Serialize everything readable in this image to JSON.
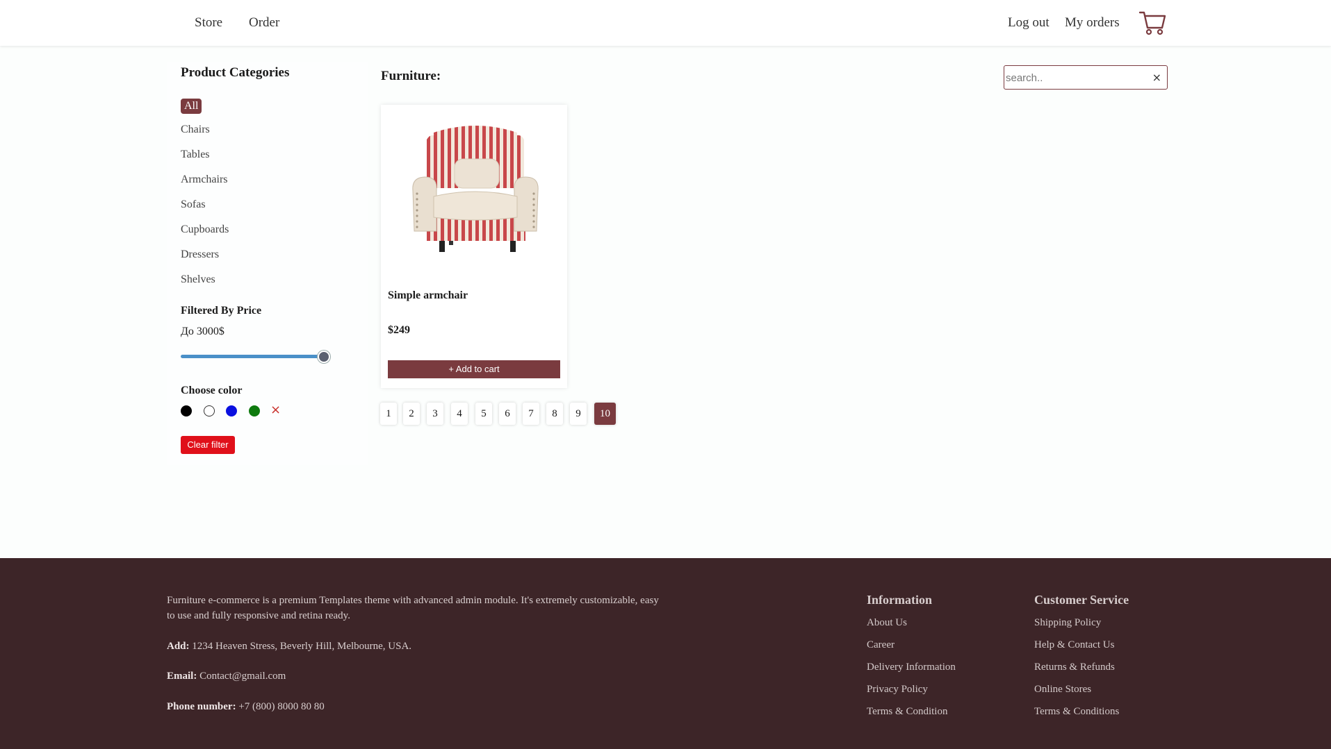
{
  "header": {
    "nav": [
      {
        "label": "Store"
      },
      {
        "label": "Order"
      }
    ],
    "right": [
      {
        "label": "Log out"
      },
      {
        "label": "My orders"
      }
    ],
    "cart_icon": "shopping-cart-icon"
  },
  "sidebar": {
    "title": "Product Categories",
    "categories": [
      {
        "label": "All",
        "selected": true
      },
      {
        "label": "Chairs"
      },
      {
        "label": "Tables"
      },
      {
        "label": "Armchairs"
      },
      {
        "label": "Sofas"
      },
      {
        "label": "Cupboards"
      },
      {
        "label": "Dressers"
      },
      {
        "label": "Shelves"
      }
    ],
    "price_title": "Filtered By Price",
    "price_value": "До 3000$",
    "price_slider_fraction": 1,
    "color_title": "Choose color",
    "colors": [
      "#000000",
      "#ffffff",
      "#0a10e0",
      "#0e7a0e"
    ],
    "color_clear": "×",
    "clear_filter": "Clear filter"
  },
  "main": {
    "title": "Furniture:",
    "search": {
      "placeholder": "search..",
      "value": "",
      "clear": "×"
    },
    "products": [
      {
        "name": "Simple armchair",
        "price": "$249",
        "button": "+ Add to cart"
      }
    ],
    "pages": [
      "1",
      "2",
      "3",
      "4",
      "5",
      "6",
      "7",
      "8",
      "9",
      "10"
    ],
    "current_page": "10"
  },
  "footer": {
    "about": "Furniture e-commerce is a premium Templates theme with advanced admin module. It's extremely customizable, easy to use and fully responsive and retina ready.",
    "address_label": "Add:",
    "address": "1234 Heaven Stress, Beverly Hill, Melbourne, USA.",
    "email_label": "Email:",
    "email": "Contact@gmail.com",
    "phone_label": "Phone number:",
    "phone": "+7 (800) 8000 80 80",
    "info_title": "Information",
    "info_links": [
      "About Us",
      "Career",
      "Delivery Information",
      "Privacy Policy",
      "Terms & Condition"
    ],
    "service_title": "Customer Service",
    "service_links": [
      "Shipping Policy",
      "Help & Contact Us",
      "Returns & Refunds",
      "Online Stores",
      "Terms & Conditions"
    ]
  },
  "colors": {
    "accent": "#7a3b3f",
    "footer_bg": "#3d2528",
    "danger": "#e0101a"
  }
}
